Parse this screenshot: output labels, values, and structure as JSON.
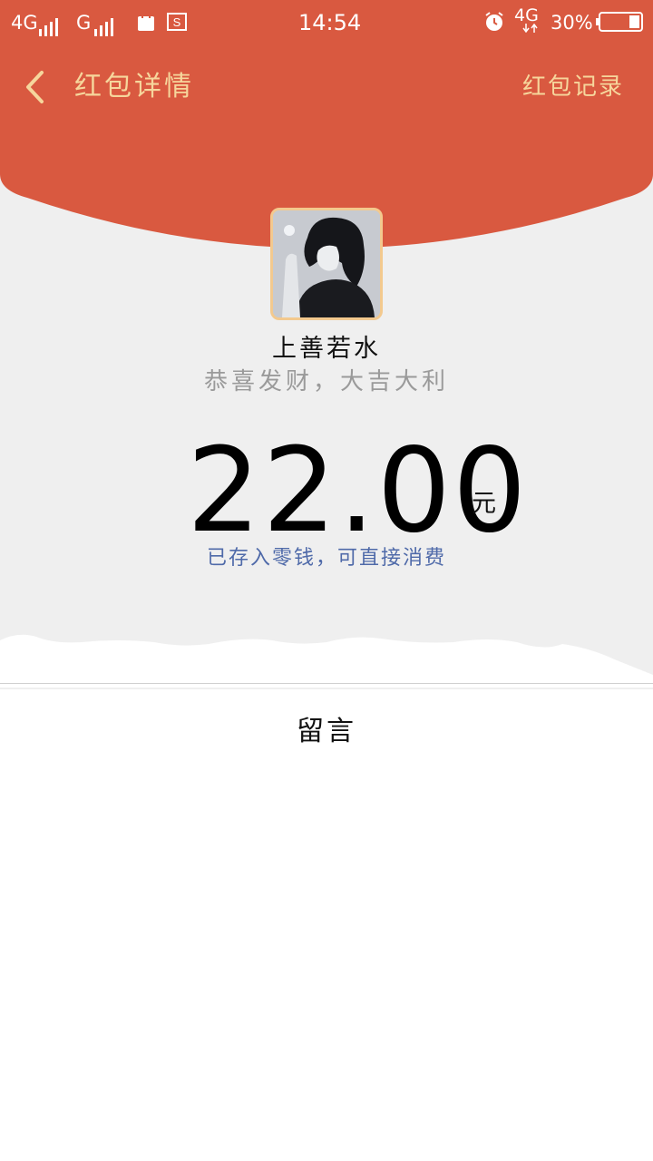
{
  "status_bar": {
    "network_1": "4G",
    "network_2": "G",
    "time": "14:54",
    "data_network": "4G",
    "battery": "30%"
  },
  "nav": {
    "title": "红包详情",
    "right_action": "红包记录"
  },
  "packet": {
    "sender_name": "上善若水",
    "greeting": "恭喜发财，大吉大利",
    "amount": "22.00",
    "unit": "元",
    "stored_note": "已存入零钱，可直接消费"
  },
  "message_section": {
    "label": "留言"
  },
  "colors": {
    "header_red": "#d95940",
    "nav_gold": "#f6d69c",
    "avatar_border": "#f3c98e",
    "note_blue": "#4f6aa9",
    "page_gray": "#efefef"
  }
}
